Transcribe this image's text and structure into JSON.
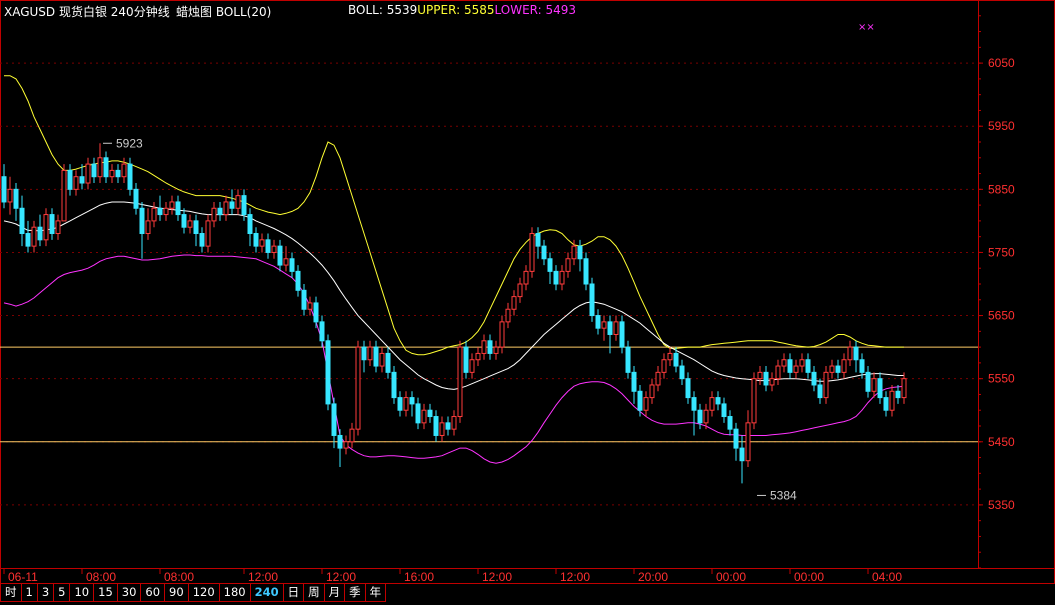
{
  "header": {
    "symbol_title": "XAGUSD 现货白银 240分钟线",
    "chart_kind": "蜡烛图 BOLL(20)",
    "boll_label": "BOLL:",
    "boll_value": "5539",
    "upper_label": "UPPER:",
    "upper_value": "5585",
    "lower_label": "LOWER:",
    "lower_value": "5493",
    "marker": "××"
  },
  "colors": {
    "background": "#000000",
    "frame": "#c00000",
    "axis_text": "#ff3030",
    "grid_dash": "#7a0000",
    "up_candle": "#ff3c3c",
    "down_candle": "#37e6ff",
    "mid_band": "#ffffff",
    "upper_band": "#ffff33",
    "lower_band": "#ff33ff",
    "hline": "#ffcc66",
    "boll_text": "#ffffff",
    "upper_text": "#ffff33",
    "lower_text": "#ff33ff",
    "tab_active": "#3ec8ff"
  },
  "timeframe_tabs": [
    "时",
    "1",
    "3",
    "5",
    "10",
    "15",
    "30",
    "60",
    "90",
    "120",
    "180",
    "240",
    "日",
    "周",
    "月",
    "季",
    "年"
  ],
  "active_tab": "240",
  "chart_data": {
    "type": "candlestick",
    "ylim": [
      5250,
      6150
    ],
    "y_ticks": [
      6050,
      5950,
      5850,
      5750,
      5650,
      5550,
      5450,
      5350
    ],
    "x_tick_labels": [
      "06-11",
      "08:00",
      "08:00",
      "12:00",
      "12:00",
      "16:00",
      "12:00",
      "12:00",
      "20:00",
      "00:00",
      "00:00",
      "04:00"
    ],
    "x_tick_index": [
      0,
      13,
      26,
      40,
      53,
      66,
      79,
      92,
      105,
      118,
      131,
      144
    ],
    "horizontal_lines": [
      5600,
      5450
    ],
    "annotations": [
      {
        "label": "5923",
        "index": 16,
        "value": 5923
      },
      {
        "label": "5384",
        "index": 125,
        "value": 5384
      }
    ],
    "candles": [
      [
        5870,
        5830,
        5890,
        5820
      ],
      [
        5830,
        5850,
        5870,
        5810
      ],
      [
        5850,
        5820,
        5860,
        5800
      ],
      [
        5820,
        5780,
        5840,
        5760
      ],
      [
        5780,
        5760,
        5800,
        5750
      ],
      [
        5760,
        5790,
        5800,
        5750
      ],
      [
        5790,
        5770,
        5810,
        5760
      ],
      [
        5770,
        5810,
        5820,
        5760
      ],
      [
        5810,
        5780,
        5820,
        5770
      ],
      [
        5780,
        5800,
        5810,
        5770
      ],
      [
        5800,
        5880,
        5890,
        5800
      ],
      [
        5880,
        5850,
        5890,
        5840
      ],
      [
        5850,
        5870,
        5880,
        5840
      ],
      [
        5870,
        5860,
        5890,
        5850
      ],
      [
        5860,
        5890,
        5900,
        5850
      ],
      [
        5890,
        5870,
        5900,
        5860
      ],
      [
        5870,
        5900,
        5923,
        5860
      ],
      [
        5900,
        5870,
        5910,
        5860
      ],
      [
        5870,
        5880,
        5890,
        5860
      ],
      [
        5880,
        5870,
        5890,
        5860
      ],
      [
        5870,
        5890,
        5900,
        5860
      ],
      [
        5890,
        5850,
        5900,
        5840
      ],
      [
        5850,
        5820,
        5860,
        5810
      ],
      [
        5820,
        5780,
        5830,
        5740
      ],
      [
        5780,
        5800,
        5820,
        5770
      ],
      [
        5800,
        5820,
        5830,
        5790
      ],
      [
        5820,
        5810,
        5840,
        5800
      ],
      [
        5810,
        5820,
        5830,
        5800
      ],
      [
        5820,
        5830,
        5840,
        5810
      ],
      [
        5830,
        5810,
        5840,
        5800
      ],
      [
        5810,
        5790,
        5820,
        5780
      ],
      [
        5790,
        5800,
        5810,
        5780
      ],
      [
        5800,
        5780,
        5810,
        5760
      ],
      [
        5780,
        5760,
        5790,
        5750
      ],
      [
        5760,
        5800,
        5810,
        5750
      ],
      [
        5800,
        5820,
        5830,
        5790
      ],
      [
        5820,
        5810,
        5830,
        5800
      ],
      [
        5810,
        5830,
        5840,
        5800
      ],
      [
        5830,
        5820,
        5850,
        5810
      ],
      [
        5820,
        5840,
        5850,
        5810
      ],
      [
        5840,
        5810,
        5850,
        5800
      ],
      [
        5810,
        5780,
        5820,
        5760
      ],
      [
        5780,
        5760,
        5790,
        5750
      ],
      [
        5760,
        5770,
        5780,
        5750
      ],
      [
        5770,
        5750,
        5780,
        5740
      ],
      [
        5750,
        5760,
        5770,
        5740
      ],
      [
        5760,
        5730,
        5770,
        5720
      ],
      [
        5730,
        5740,
        5760,
        5720
      ],
      [
        5740,
        5720,
        5750,
        5710
      ],
      [
        5720,
        5690,
        5730,
        5680
      ],
      [
        5690,
        5660,
        5700,
        5650
      ],
      [
        5660,
        5670,
        5680,
        5650
      ],
      [
        5670,
        5640,
        5680,
        5630
      ],
      [
        5640,
        5610,
        5650,
        5600
      ],
      [
        5610,
        5510,
        5620,
        5500
      ],
      [
        5510,
        5460,
        5520,
        5440
      ],
      [
        5460,
        5440,
        5470,
        5410
      ],
      [
        5440,
        5450,
        5460,
        5430
      ],
      [
        5450,
        5470,
        5480,
        5440
      ],
      [
        5470,
        5600,
        5610,
        5460
      ],
      [
        5600,
        5580,
        5610,
        5560
      ],
      [
        5580,
        5600,
        5610,
        5570
      ],
      [
        5600,
        5570,
        5610,
        5560
      ],
      [
        5570,
        5590,
        5600,
        5560
      ],
      [
        5590,
        5560,
        5600,
        5550
      ],
      [
        5560,
        5520,
        5570,
        5510
      ],
      [
        5520,
        5500,
        5530,
        5490
      ],
      [
        5500,
        5520,
        5530,
        5490
      ],
      [
        5520,
        5510,
        5530,
        5490
      ],
      [
        5510,
        5480,
        5520,
        5470
      ],
      [
        5480,
        5500,
        5510,
        5470
      ],
      [
        5500,
        5490,
        5510,
        5480
      ],
      [
        5490,
        5460,
        5500,
        5450
      ],
      [
        5460,
        5480,
        5490,
        5450
      ],
      [
        5480,
        5470,
        5490,
        5460
      ],
      [
        5470,
        5490,
        5500,
        5460
      ],
      [
        5490,
        5600,
        5610,
        5480
      ],
      [
        5600,
        5560,
        5610,
        5550
      ],
      [
        5560,
        5580,
        5590,
        5550
      ],
      [
        5580,
        5590,
        5600,
        5570
      ],
      [
        5590,
        5610,
        5620,
        5580
      ],
      [
        5610,
        5590,
        5620,
        5580
      ],
      [
        5590,
        5600,
        5610,
        5580
      ],
      [
        5600,
        5640,
        5650,
        5590
      ],
      [
        5640,
        5660,
        5670,
        5630
      ],
      [
        5660,
        5680,
        5690,
        5650
      ],
      [
        5680,
        5700,
        5710,
        5670
      ],
      [
        5700,
        5720,
        5730,
        5690
      ],
      [
        5720,
        5780,
        5790,
        5710
      ],
      [
        5780,
        5760,
        5790,
        5740
      ],
      [
        5760,
        5740,
        5770,
        5730
      ],
      [
        5740,
        5720,
        5750,
        5700
      ],
      [
        5720,
        5700,
        5730,
        5690
      ],
      [
        5700,
        5720,
        5730,
        5690
      ],
      [
        5720,
        5740,
        5750,
        5710
      ],
      [
        5740,
        5760,
        5770,
        5730
      ],
      [
        5760,
        5740,
        5770,
        5720
      ],
      [
        5740,
        5700,
        5750,
        5690
      ],
      [
        5700,
        5650,
        5710,
        5640
      ],
      [
        5650,
        5630,
        5660,
        5620
      ],
      [
        5630,
        5640,
        5650,
        5610
      ],
      [
        5640,
        5620,
        5650,
        5590
      ],
      [
        5620,
        5640,
        5650,
        5610
      ],
      [
        5640,
        5600,
        5650,
        5590
      ],
      [
        5600,
        5560,
        5610,
        5550
      ],
      [
        5560,
        5530,
        5570,
        5510
      ],
      [
        5530,
        5500,
        5540,
        5490
      ],
      [
        5500,
        5520,
        5530,
        5490
      ],
      [
        5520,
        5540,
        5550,
        5510
      ],
      [
        5540,
        5560,
        5570,
        5530
      ],
      [
        5560,
        5580,
        5590,
        5550
      ],
      [
        5580,
        5590,
        5600,
        5570
      ],
      [
        5590,
        5570,
        5600,
        5560
      ],
      [
        5570,
        5550,
        5580,
        5540
      ],
      [
        5550,
        5520,
        5560,
        5510
      ],
      [
        5520,
        5500,
        5530,
        5460
      ],
      [
        5500,
        5480,
        5510,
        5470
      ],
      [
        5480,
        5500,
        5510,
        5470
      ],
      [
        5500,
        5520,
        5530,
        5490
      ],
      [
        5520,
        5510,
        5530,
        5500
      ],
      [
        5510,
        5490,
        5520,
        5480
      ],
      [
        5490,
        5470,
        5500,
        5460
      ],
      [
        5470,
        5440,
        5480,
        5420
      ],
      [
        5440,
        5420,
        5460,
        5384
      ],
      [
        5420,
        5480,
        5500,
        5410
      ],
      [
        5480,
        5550,
        5560,
        5470
      ],
      [
        5550,
        5560,
        5570,
        5540
      ],
      [
        5560,
        5540,
        5570,
        5530
      ],
      [
        5540,
        5550,
        5560,
        5530
      ],
      [
        5550,
        5570,
        5580,
        5540
      ],
      [
        5570,
        5580,
        5590,
        5560
      ],
      [
        5580,
        5560,
        5590,
        5550
      ],
      [
        5560,
        5570,
        5580,
        5550
      ],
      [
        5570,
        5580,
        5590,
        5560
      ],
      [
        5580,
        5560,
        5590,
        5550
      ],
      [
        5560,
        5540,
        5570,
        5530
      ],
      [
        5540,
        5520,
        5550,
        5510
      ],
      [
        5520,
        5560,
        5570,
        5510
      ],
      [
        5560,
        5570,
        5580,
        5550
      ],
      [
        5570,
        5560,
        5580,
        5550
      ],
      [
        5560,
        5580,
        5590,
        5550
      ],
      [
        5580,
        5600,
        5610,
        5570
      ],
      [
        5600,
        5580,
        5610,
        5560
      ],
      [
        5580,
        5560,
        5590,
        5550
      ],
      [
        5560,
        5530,
        5570,
        5520
      ],
      [
        5530,
        5550,
        5560,
        5520
      ],
      [
        5550,
        5520,
        5560,
        5510
      ],
      [
        5520,
        5500,
        5530,
        5490
      ],
      [
        5500,
        5530,
        5540,
        5490
      ],
      [
        5530,
        5520,
        5540,
        5510
      ],
      [
        5520,
        5550,
        5560,
        5510
      ]
    ],
    "mid_band": [
      5800,
      5798,
      5795,
      5790,
      5785,
      5785,
      5784,
      5786,
      5787,
      5790,
      5795,
      5800,
      5805,
      5810,
      5815,
      5820,
      5825,
      5828,
      5830,
      5830,
      5830,
      5829,
      5828,
      5826,
      5824,
      5822,
      5820,
      5819,
      5818,
      5817,
      5816,
      5815,
      5813,
      5811,
      5810,
      5810,
      5810,
      5810,
      5810,
      5810,
      5808,
      5805,
      5800,
      5796,
      5792,
      5788,
      5783,
      5778,
      5772,
      5765,
      5757,
      5749,
      5740,
      5730,
      5718,
      5705,
      5690,
      5676,
      5663,
      5650,
      5640,
      5630,
      5620,
      5610,
      5600,
      5590,
      5580,
      5572,
      5564,
      5556,
      5550,
      5545,
      5540,
      5536,
      5534,
      5533,
      5535,
      5538,
      5542,
      5546,
      5550,
      5554,
      5558,
      5562,
      5566,
      5572,
      5580,
      5590,
      5600,
      5610,
      5620,
      5628,
      5636,
      5644,
      5652,
      5660,
      5666,
      5670,
      5672,
      5670,
      5668,
      5664,
      5660,
      5656,
      5650,
      5644,
      5638,
      5630,
      5622,
      5614,
      5606,
      5600,
      5595,
      5590,
      5585,
      5580,
      5574,
      5568,
      5562,
      5558,
      5555,
      5553,
      5551,
      5550,
      5549,
      5548,
      5547,
      5547,
      5548,
      5549,
      5550,
      5550,
      5550,
      5549,
      5548,
      5547,
      5546,
      5546,
      5547,
      5548,
      5550,
      5552,
      5554,
      5556,
      5557,
      5558,
      5558,
      5557,
      5556,
      5555,
      5555
    ],
    "upper_band": [
      6030,
      6030,
      6025,
      6010,
      5990,
      5965,
      5945,
      5925,
      5905,
      5890,
      5880,
      5880,
      5882,
      5885,
      5888,
      5890,
      5892,
      5893,
      5895,
      5895,
      5893,
      5890,
      5886,
      5882,
      5878,
      5872,
      5866,
      5860,
      5855,
      5850,
      5846,
      5843,
      5840,
      5840,
      5840,
      5840,
      5840,
      5838,
      5836,
      5833,
      5830,
      5825,
      5820,
      5817,
      5814,
      5812,
      5810,
      5812,
      5815,
      5820,
      5830,
      5845,
      5870,
      5900,
      5925,
      5920,
      5900,
      5870,
      5840,
      5810,
      5780,
      5750,
      5720,
      5690,
      5660,
      5630,
      5610,
      5595,
      5590,
      5588,
      5588,
      5590,
      5593,
      5596,
      5600,
      5602,
      5604,
      5608,
      5615,
      5625,
      5640,
      5660,
      5680,
      5700,
      5720,
      5740,
      5755,
      5766,
      5775,
      5780,
      5784,
      5786,
      5785,
      5780,
      5770,
      5762,
      5760,
      5763,
      5768,
      5775,
      5775,
      5770,
      5760,
      5745,
      5725,
      5703,
      5680,
      5660,
      5640,
      5620,
      5604,
      5598,
      5598,
      5599,
      5600,
      5600,
      5600,
      5602,
      5604,
      5605,
      5606,
      5607,
      5608,
      5609,
      5610,
      5610,
      5610,
      5610,
      5610,
      5608,
      5606,
      5604,
      5602,
      5601,
      5600,
      5601,
      5604,
      5608,
      5614,
      5620,
      5620,
      5616,
      5610,
      5606,
      5603,
      5602,
      5601,
      5600,
      5600,
      5600,
      5600
    ],
    "lower_band": [
      5670,
      5668,
      5665,
      5668,
      5672,
      5678,
      5686,
      5694,
      5702,
      5710,
      5715,
      5718,
      5720,
      5722,
      5725,
      5730,
      5736,
      5740,
      5742,
      5744,
      5744,
      5742,
      5740,
      5738,
      5738,
      5739,
      5740,
      5742,
      5744,
      5745,
      5746,
      5746,
      5745,
      5745,
      5744,
      5744,
      5744,
      5744,
      5744,
      5743,
      5742,
      5741,
      5740,
      5736,
      5732,
      5728,
      5722,
      5716,
      5710,
      5700,
      5685,
      5665,
      5640,
      5610,
      5560,
      5510,
      5460,
      5445,
      5438,
      5432,
      5428,
      5426,
      5426,
      5427,
      5428,
      5428,
      5427,
      5426,
      5425,
      5424,
      5424,
      5425,
      5426,
      5428,
      5432,
      5436,
      5440,
      5440,
      5436,
      5430,
      5423,
      5418,
      5416,
      5418,
      5422,
      5428,
      5435,
      5442,
      5452,
      5465,
      5480,
      5494,
      5508,
      5520,
      5530,
      5538,
      5542,
      5544,
      5545,
      5545,
      5544,
      5540,
      5534,
      5526,
      5516,
      5506,
      5498,
      5490,
      5484,
      5480,
      5478,
      5478,
      5478,
      5479,
      5480,
      5480,
      5478,
      5475,
      5470,
      5465,
      5462,
      5461,
      5461,
      5460,
      5460,
      5460,
      5460,
      5460,
      5461,
      5462,
      5463,
      5464,
      5466,
      5468,
      5470,
      5472,
      5474,
      5476,
      5478,
      5480,
      5482,
      5485,
      5490,
      5500,
      5512,
      5522,
      5530,
      5534,
      5536,
      5537,
      5538
    ]
  }
}
